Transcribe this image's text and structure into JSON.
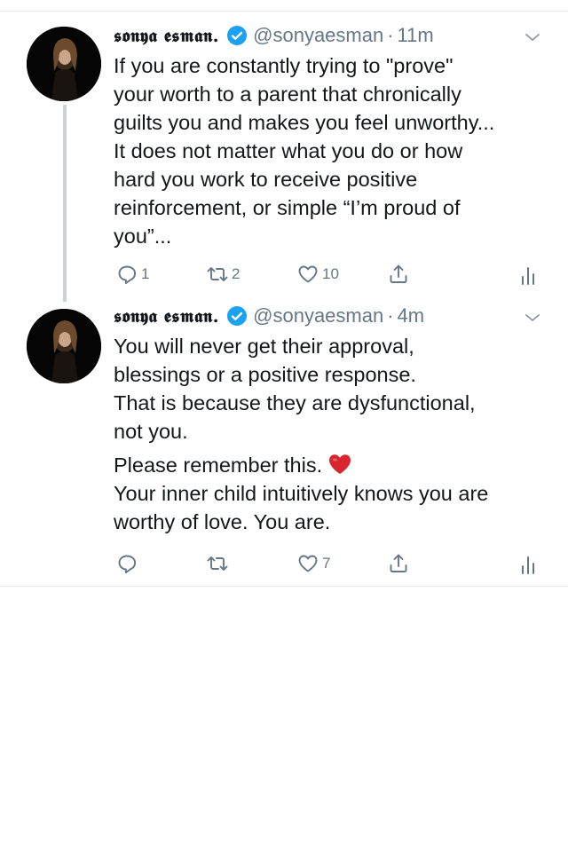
{
  "tweets": [
    {
      "display_name": "𝖘𝖔𝖓𝖞𝖆 𝖊𝖘𝖒𝖆𝖓.",
      "handle": "@sonyaesman",
      "separator": "·",
      "time": "11m",
      "text_lines": [
        "If you are constantly trying to \"prove\"",
        "your worth to a parent that chronically",
        "guilts you and makes you feel unworthy...",
        "It does not matter what you do or how",
        "hard you work to receive positive",
        "reinforcement, or simple “I’m proud of",
        "you”..."
      ],
      "actions": {
        "reply_count": "1",
        "retweet_count": "2",
        "like_count": "10"
      }
    },
    {
      "display_name": "𝖘𝖔𝖓𝖞𝖆 𝖊𝖘𝖒𝖆𝖓.",
      "handle": "@sonyaesman",
      "separator": "·",
      "time": "4m",
      "text_lines": [
        "You will never get their approval,",
        "blessings or a positive response.",
        "That is because they are dysfunctional,",
        "not you."
      ],
      "text_lines_2": [
        "Please remember this.",
        "Your inner child intuitively knows you are",
        "worthy of love. You are."
      ],
      "emoji": "red-heart",
      "actions": {
        "reply_count": "",
        "retweet_count": "",
        "like_count": "7"
      }
    }
  ],
  "icons": {
    "verified": "verified-badge-icon",
    "caret": "chevron-down-icon",
    "reply": "reply-icon",
    "retweet": "retweet-icon",
    "like": "heart-icon",
    "share": "share-icon",
    "analytics": "analytics-icon"
  },
  "colors": {
    "verified_blue": "#1da1f2",
    "icon_gray": "#657786",
    "heart_red": "#d9262e"
  }
}
